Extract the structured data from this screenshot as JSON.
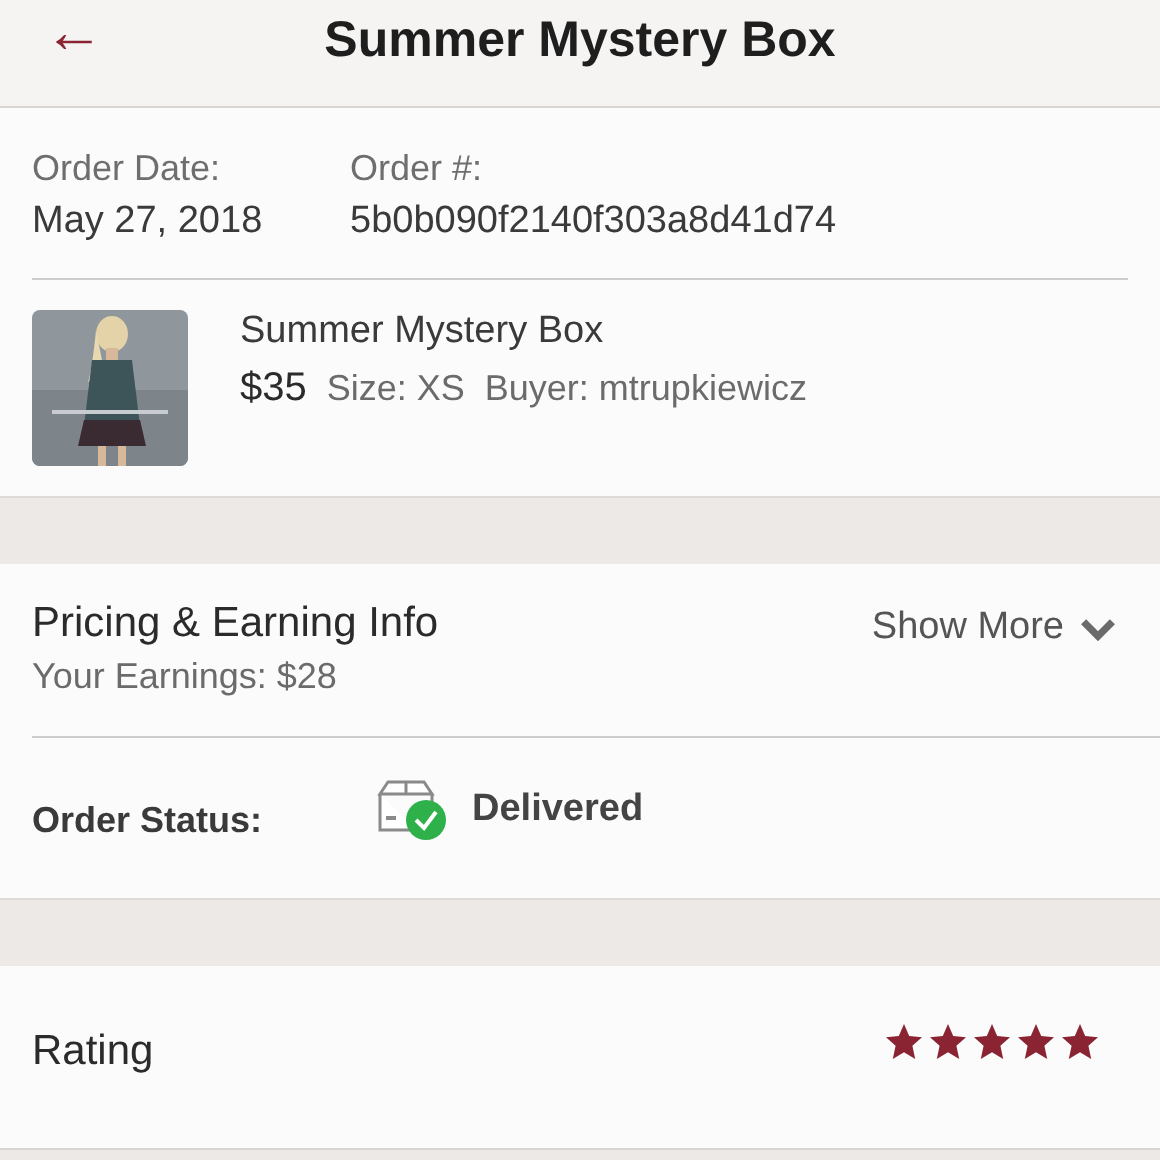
{
  "header": {
    "back": "←",
    "title": "Summer Mystery Box"
  },
  "order": {
    "date_label": "Order Date:",
    "date": "May 27, 2018",
    "number_label": "Order #:",
    "number": "5b0b090f2140f303a8d41d74"
  },
  "item": {
    "kind": "picture",
    "title": "Summer Mystery Box",
    "price": "$35",
    "size": "Size: XS",
    "buyer": "Buyer: mtrupkiewicz"
  },
  "pricing": {
    "title": "Pricing & Earning Info",
    "earnings": "Your Earnings: $28",
    "toggle": "Show More",
    "expanded": false
  },
  "status": {
    "label": "Order Status:",
    "value": "Delivered",
    "delivered": true
  },
  "rating": {
    "label": "Rating",
    "stars": 5
  }
}
